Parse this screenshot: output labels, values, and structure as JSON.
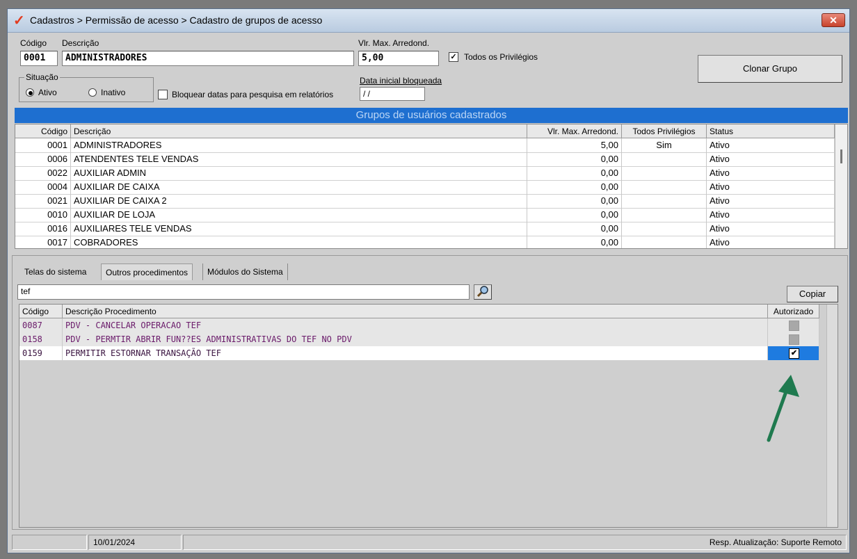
{
  "window": {
    "title": "Cadastros > Permissão de acesso > Cadastro de grupos de acesso",
    "app_icon": "check-logo-icon",
    "close_symbol": "✕"
  },
  "form": {
    "codigo_label": "Código",
    "codigo_value": "0001",
    "descricao_label": "Descrição",
    "descricao_value": "ADMINISTRADORES",
    "vlr_label": "Vlr. Max. Arredond.",
    "vlr_value": "5,00",
    "todos_privilegios_label": "Todos os Privilégios",
    "todos_privilegios_checked": true,
    "situacao_label": "Situação",
    "ativo_label": "Ativo",
    "inativo_label": "Inativo",
    "situacao_selected": "Ativo",
    "bloquear_label": "Bloquear datas para pesquisa em relatórios",
    "bloquear_checked": false,
    "data_inicial_label": "Data inicial bloqueada",
    "data_inicial_value": " / /",
    "clonar_button": "Clonar Grupo"
  },
  "groups_section": {
    "title": "Grupos de usuários cadastrados",
    "headers": [
      "Código",
      "Descrição",
      "Vlr. Max. Arredond.",
      "Todos Privilégios",
      "Status"
    ],
    "rows": [
      {
        "codigo": "0001",
        "descricao": "ADMINISTRADORES",
        "vlr": "5,00",
        "todos": "Sim",
        "status": "Ativo"
      },
      {
        "codigo": "0006",
        "descricao": "ATENDENTES TELE VENDAS",
        "vlr": "0,00",
        "todos": "",
        "status": "Ativo"
      },
      {
        "codigo": "0022",
        "descricao": "AUXILIAR ADMIN",
        "vlr": "0,00",
        "todos": "",
        "status": "Ativo"
      },
      {
        "codigo": "0004",
        "descricao": "AUXILIAR DE CAIXA",
        "vlr": "0,00",
        "todos": "",
        "status": "Ativo"
      },
      {
        "codigo": "0021",
        "descricao": "AUXILIAR DE CAIXA 2",
        "vlr": "0,00",
        "todos": "",
        "status": "Ativo"
      },
      {
        "codigo": "0010",
        "descricao": "AUXILIAR DE LOJA",
        "vlr": "0,00",
        "todos": "",
        "status": "Ativo"
      },
      {
        "codigo": "0016",
        "descricao": "AUXILIARES TELE VENDAS",
        "vlr": "0,00",
        "todos": "",
        "status": "Ativo"
      },
      {
        "codigo": "0017",
        "descricao": "COBRADORES",
        "vlr": "0,00",
        "todos": "",
        "status": "Ativo"
      }
    ]
  },
  "tabs": [
    {
      "label": "Telas do sistema",
      "active": false
    },
    {
      "label": "Outros procedimentos",
      "active": true
    },
    {
      "label": "Módulos do Sistema",
      "active": false
    }
  ],
  "procedures": {
    "search_value": "tef",
    "search_icon": "search-icon",
    "copy_button": "Copiar",
    "headers": [
      "Código",
      "Descrição Procedimento",
      "Autorizado"
    ],
    "rows": [
      {
        "codigo": "0087",
        "descricao": "PDV - CANCELAR OPERACAO TEF",
        "autorizado": false,
        "selected": false
      },
      {
        "codigo": "0158",
        "descricao": "PDV - PERMTIR ABRIR FUN??ES ADMINISTRATIVAS DO TEF NO PDV",
        "autorizado": false,
        "selected": false
      },
      {
        "codigo": "0159",
        "descricao": "PERMITIR ESTORNAR TRANSAÇÃO TEF",
        "autorizado": true,
        "selected": true
      }
    ],
    "check_mark": "✔"
  },
  "annotation": {
    "arrow_color": "#1f7a4f"
  },
  "status_bar": {
    "date": "10/01/2024",
    "resp": "Resp. Atualização: Suporte Remoto"
  },
  "colors": {
    "band": "#1e6fd0",
    "selection": "#1e7be0",
    "proc_text": "#6a1a6a"
  }
}
